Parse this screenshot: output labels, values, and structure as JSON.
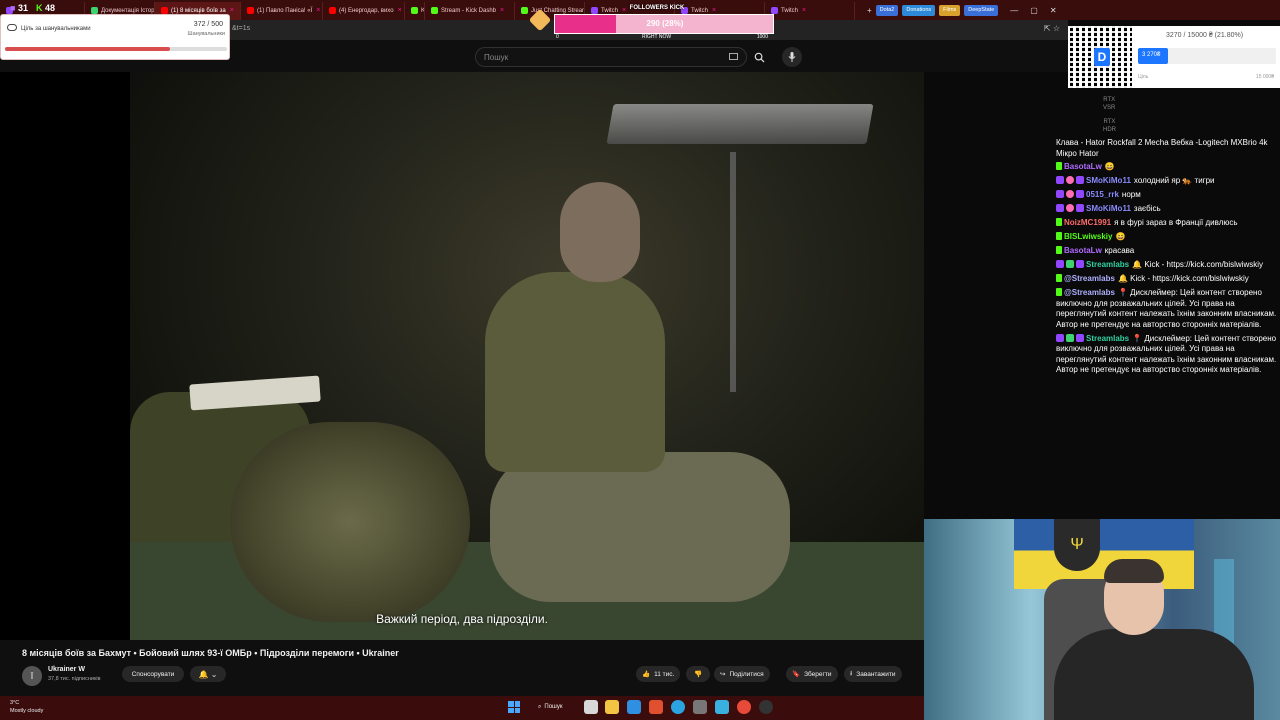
{
  "browser": {
    "tabs": [
      {
        "label": "",
        "color": "#9146ff",
        "active": false
      },
      {
        "label": "Документація Історія",
        "color": "#3dd36f",
        "active": false
      },
      {
        "label": "(1) 8 місяців боїв за",
        "color": "#ff0000",
        "active": true
      },
      {
        "label": "(1) Павло Паніса! «Ї",
        "color": "#ff0000",
        "active": false
      },
      {
        "label": "(4) Енергодар, вихо",
        "color": "#ff0000",
        "active": false
      },
      {
        "label": "Kick",
        "color": "#53fc18",
        "active": false
      },
      {
        "label": "Stream - Kick Dashb",
        "color": "#53fc18",
        "active": false
      },
      {
        "label": "Just Chatting Stream",
        "color": "#53fc18",
        "active": false
      },
      {
        "label": "Twitch",
        "color": "#9146ff",
        "active": false
      },
      {
        "label": "Twitch",
        "color": "#9146ff",
        "active": false
      },
      {
        "label": "Twitch",
        "color": "#9146ff",
        "active": false
      }
    ],
    "pills": [
      {
        "label": "Dota2",
        "color": "#3a6fd8"
      },
      {
        "label": "Donations",
        "color": "#2d8ad8"
      },
      {
        "label": "Films",
        "color": "#d8a12d"
      },
      {
        "label": "DeepState",
        "color": "#3a6fd8"
      }
    ],
    "url_fragment": "&t=1s"
  },
  "badges": {
    "twitch": "31",
    "kick": "48"
  },
  "followers_overlay": {
    "label": "Ціль за шанувальниками",
    "current": "372",
    "target": "500",
    "count_text": "372 / 500",
    "sublabel": "Шанувальники",
    "progress": 0.744
  },
  "kick_goal": {
    "title": "FOLLOWERS KICK",
    "value_text": "290 (28%)",
    "progress": 0.28,
    "min": "0",
    "mid": "RIGHT NOW",
    "max": "1000"
  },
  "youtube": {
    "search_placeholder": "Пошук",
    "subtitle": "Важкий період, два підрозділи.",
    "video_title": "8 місяців боїв за Бахмут • Бойовий шлях 93-ї ОМБр • Підрозділи перемоги • Ukrainer",
    "channel_name": "Ukrainer W",
    "channel_subs": "37,8 тис. підписників",
    "sponsor_label": "Спонсорувати",
    "like_count": "11 тис.",
    "share_label": "Поділитися",
    "save_label": "Зберегти",
    "download_label": "Завантажити"
  },
  "donation_goal": {
    "text": "3270 / 15000 ₴ (21.80%)",
    "bar_label": "3 270₴",
    "progress": 0.218,
    "min_label": "Ціль",
    "max_label": "15 000₴"
  },
  "rtx": {
    "vsr": "RTX\nVSR",
    "hdr": "RTX\nHDR"
  },
  "chat": {
    "header": "Клава - Hator Rockfall 2 Mecha Вебка -Logitech MXBrio 4k Мікро Hator",
    "messages": [
      {
        "badges": [
          "kick"
        ],
        "user": "BasotaLw",
        "user_color": "#b06cff",
        "text": "😄"
      },
      {
        "badges": [
          "tw",
          "heart",
          "tw"
        ],
        "user": "SMoKiMo11",
        "user_color": "#8a8aff",
        "text": "холодний яр 🐅 тигри"
      },
      {
        "badges": [
          "tw",
          "heart",
          "tw"
        ],
        "user": "0515_rrk",
        "user_color": "#8a8aff",
        "text": "норм"
      },
      {
        "badges": [
          "tw",
          "heart",
          "tw"
        ],
        "user": "SMoKiMo11",
        "user_color": "#8a8aff",
        "text": "заєбісь"
      },
      {
        "badges": [
          "kick"
        ],
        "user": "NoizMC1991",
        "user_color": "#ff6b6b",
        "text": "я в фурі зараз в Франції дивлюсь"
      },
      {
        "badges": [
          "kick"
        ],
        "user": "BISLwiwskiy",
        "user_color": "#53fc18",
        "text": "😄"
      },
      {
        "badges": [
          "kick"
        ],
        "user": "BasotaLw",
        "user_color": "#b06cff",
        "text": "красава"
      },
      {
        "badges": [
          "tw",
          "ck",
          "tw"
        ],
        "user": "Streamlabs",
        "user_color": "#31d1a0",
        "text": "🔔 Kick - https://kick.com/bislwiwskiy"
      },
      {
        "badges": [
          "kick"
        ],
        "user": "@Streamlabs",
        "user_color": "#b0b0ff",
        "text": "🔔 Kick - https://kick.com/bislwiwskiy"
      },
      {
        "badges": [
          "kick"
        ],
        "user": "@Streamlabs",
        "user_color": "#b0b0ff",
        "text": "📍 Дисклеймер: Цей контент створено виключно для розважальних цілей. Усі права на переглянутий контент належать їхнім законним власникам. Автор не претендує на авторство сторонніх матеріалів."
      },
      {
        "badges": [
          "tw",
          "ck",
          "tw"
        ],
        "user": "Streamlabs",
        "user_color": "#31d1a0",
        "text": "📍 Дисклеймер: Цей контент створено виключно для розважальних цілей. Усі права на переглянутий контент належать їхнім законним власникам. Автор не претендує на авторство сторонніх матеріалів."
      }
    ]
  },
  "taskbar": {
    "temp": "3°C",
    "weather": "Mostly cloudy",
    "search_label": "Пошук"
  }
}
